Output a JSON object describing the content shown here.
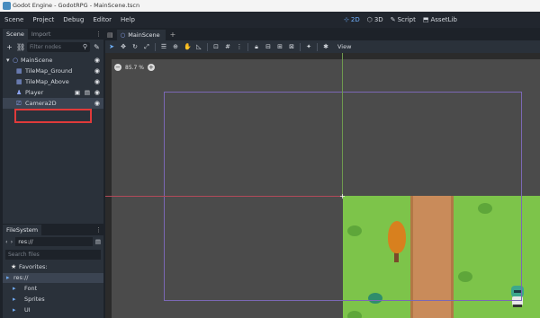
{
  "window": {
    "title": "Godot Engine - GodotRPG - MainScene.tscn"
  },
  "menu": {
    "items": [
      "Scene",
      "Project",
      "Debug",
      "Editor",
      "Help"
    ]
  },
  "workspaces": [
    {
      "label": "2D",
      "icon": "2d-icon",
      "active": true
    },
    {
      "label": "3D",
      "icon": "3d-icon",
      "active": false
    },
    {
      "label": "Script",
      "icon": "script-icon",
      "active": false
    },
    {
      "label": "AssetLib",
      "icon": "assetlib-icon",
      "active": false
    }
  ],
  "scene_dock": {
    "tabs": [
      "Scene",
      "Import"
    ],
    "filter_placeholder": "Filter nodes",
    "nodes": [
      {
        "label": "MainScene",
        "icon": "node2d-icon",
        "depth": 0
      },
      {
        "label": "TileMap_Ground",
        "icon": "tilemap-icon",
        "depth": 1
      },
      {
        "label": "TileMap_Above",
        "icon": "tilemap-icon",
        "depth": 1
      },
      {
        "label": "Player",
        "icon": "kinematicbody-icon",
        "depth": 1
      },
      {
        "label": "Camera2D",
        "icon": "camera2d-icon",
        "depth": 1,
        "selected": true
      }
    ]
  },
  "filesystem_dock": {
    "tab": "FileSystem",
    "path": "res://",
    "search_placeholder": "Search files",
    "favorites_label": "Favorites:",
    "items": [
      {
        "label": "res://",
        "type": "folder",
        "selected": true
      },
      {
        "label": "Font",
        "type": "folder"
      },
      {
        "label": "Sprites",
        "type": "folder"
      },
      {
        "label": "UI",
        "type": "folder"
      }
    ]
  },
  "editor": {
    "tabs": [
      {
        "label": "MainScene",
        "icon": "scene-icon"
      }
    ],
    "toolbar_view_label": "View",
    "zoom": "85.7 %",
    "colors": {
      "grass": "#7dc44a",
      "path": "#c98b5a",
      "camera_rect": "#7b68b5",
      "selection": "#e03a3a"
    }
  }
}
